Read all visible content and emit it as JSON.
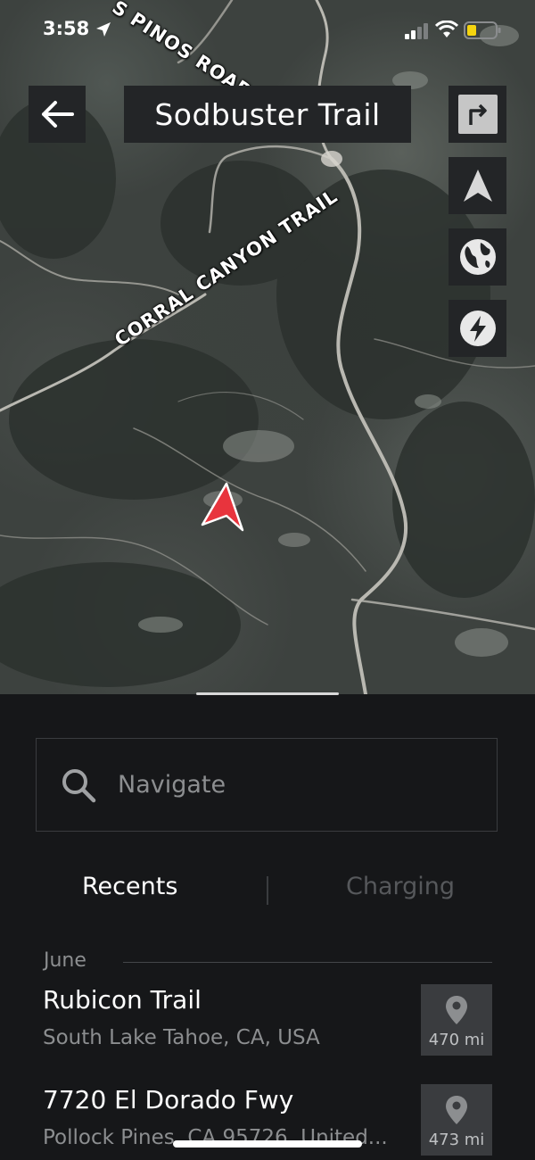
{
  "status_bar": {
    "time": "3:58"
  },
  "map": {
    "title": "Sodbuster Trail",
    "road_labels": {
      "pinos_road": "S PINOS ROAD",
      "corral_canyon": "CORRAL CANYON TRAIL"
    },
    "buttons": [
      "directions-icon",
      "navigate-arrow-icon",
      "globe-icon",
      "lightning-icon"
    ]
  },
  "search": {
    "placeholder": "Navigate"
  },
  "tabs": {
    "recents": "Recents",
    "charging": "Charging"
  },
  "recents": {
    "month": "June",
    "items": [
      {
        "title": "Rubicon Trail",
        "subtitle": "South Lake Tahoe, CA, USA",
        "distance": "470 mi"
      },
      {
        "title": "7720 El Dorado Fwy",
        "subtitle": "Pollock Pines, CA 95726, United...",
        "distance": "473 mi"
      }
    ]
  },
  "colors": {
    "map_arrow": "#e8343d",
    "sheet_bg": "#161719",
    "button_bg": "#232527",
    "inactive_text": "#56585b"
  }
}
